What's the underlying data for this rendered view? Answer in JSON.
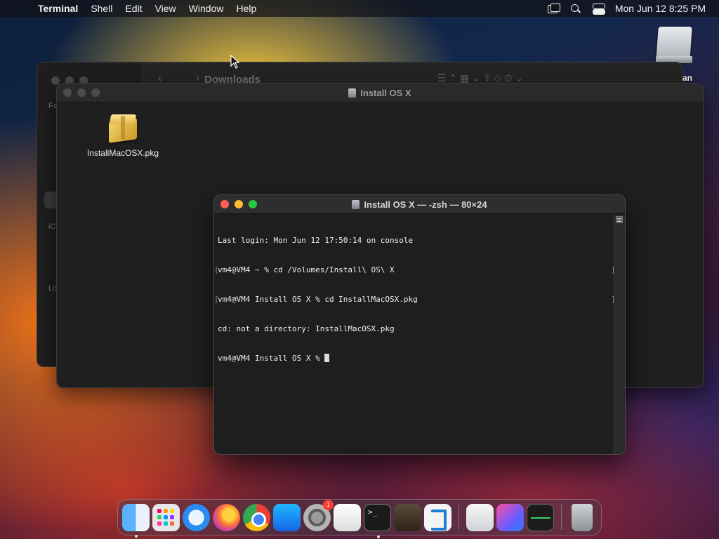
{
  "menubar": {
    "apple_glyph": "",
    "app_name": "Terminal",
    "items": [
      "Shell",
      "Edit",
      "View",
      "Window",
      "Help"
    ],
    "clock": "Mon Jun 12  8:25 PM",
    "status_icons": [
      "screen-mirroring-icon",
      "search-icon",
      "control-center-icon"
    ]
  },
  "desktop": {
    "disk_label": "an"
  },
  "finder_back": {
    "title": "Downloads",
    "nav": "‹ ›",
    "toolbar_glyphs": "☰ ⌃   ▦ ⌄   ⇪   ◇   ⊙ ⌄",
    "sidebar_labels": [
      "Fa",
      "iC",
      "Lo"
    ]
  },
  "finder_front": {
    "title": "Install OS X",
    "file": {
      "name": "InstallMacOSX.pkg",
      "icon": "package-icon"
    }
  },
  "terminal": {
    "title": "Install OS X — -zsh — 80×24",
    "lines": [
      "Last login: Mon Jun 12 17:50:14 on console",
      "vm4@VM4 ~ % cd /Volumes/Install\\ OS\\ X",
      "vm4@VM4 Install OS X % cd InstallMacOSX.pkg",
      "cd: not a directory: InstallMacOSX.pkg",
      "vm4@VM4 Install OS X % "
    ]
  },
  "dock": {
    "apps": [
      "Finder",
      "Launchpad",
      "Safari",
      "Firefox",
      "Google Chrome",
      "App Store",
      "System Settings",
      "TextEdit",
      "Terminal",
      "GarageBand",
      "Visual Studio Code",
      "System Information",
      "Shortcuts",
      "Activity Monitor",
      "Trash"
    ],
    "settings_badge": "1"
  }
}
